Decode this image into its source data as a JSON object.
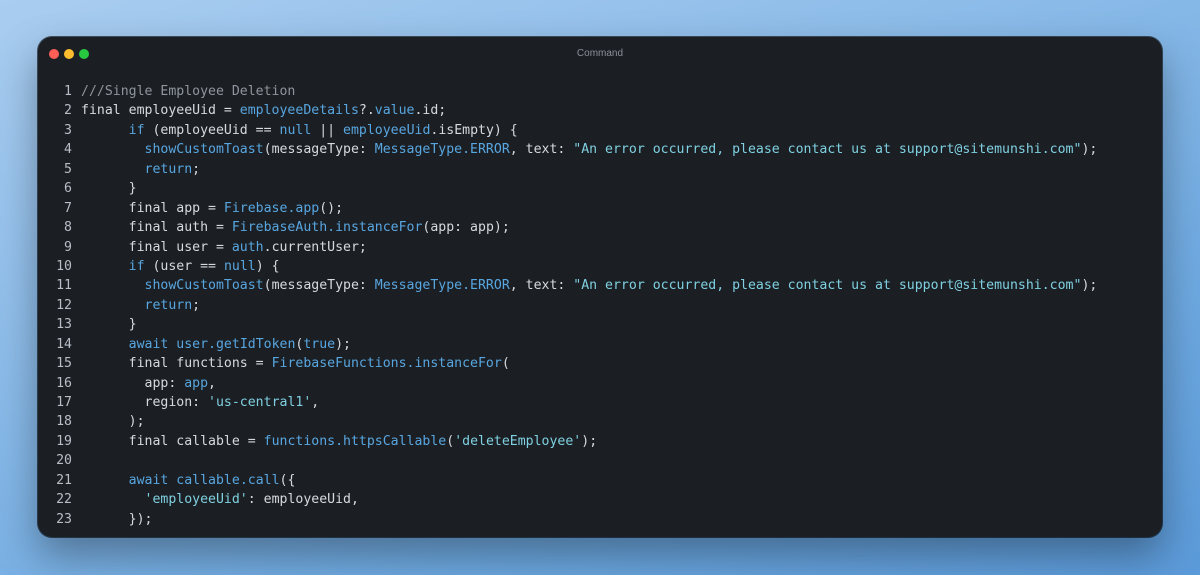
{
  "window": {
    "title": "Command",
    "traffic_lights": {
      "close": "#ff5f57",
      "minimize": "#febc2e",
      "zoom": "#28c840"
    }
  },
  "theme": {
    "background": "#1b1f24",
    "plain": "#d6dadf",
    "comment": "#8e959c",
    "keyword": "#58a6e0",
    "string": "#7fd0e0",
    "line_number": "#b8bec6"
  },
  "code_lines": [
    {
      "n": "1",
      "tokens": [
        [
          "comment",
          "///Single Employee Deletion"
        ]
      ]
    },
    {
      "n": "2",
      "tokens": [
        [
          "plain",
          "final employeeUid = "
        ],
        [
          "fn",
          "employeeDetails"
        ],
        [
          "plain",
          "?."
        ],
        [
          "fn",
          "value"
        ],
        [
          "plain",
          ".id;"
        ]
      ]
    },
    {
      "n": "3",
      "tokens": [
        [
          "plain",
          "      "
        ],
        [
          "keyword",
          "if"
        ],
        [
          "plain",
          " (employeeUid == "
        ],
        [
          "keyword",
          "null"
        ],
        [
          "plain",
          " || "
        ],
        [
          "fn",
          "employeeUid"
        ],
        [
          "plain",
          ".isEmpty) {"
        ]
      ]
    },
    {
      "n": "4",
      "tokens": [
        [
          "plain",
          "        "
        ],
        [
          "fn",
          "showCustomToast"
        ],
        [
          "plain",
          "(messageType: "
        ],
        [
          "type",
          "MessageType.ERROR"
        ],
        [
          "plain",
          ", text: "
        ],
        [
          "string",
          "\"An error occurred, please contact us at support@sitemunshi.com\""
        ],
        [
          "plain",
          ");"
        ]
      ]
    },
    {
      "n": "5",
      "tokens": [
        [
          "plain",
          "        "
        ],
        [
          "keyword",
          "return"
        ],
        [
          "plain",
          ";"
        ]
      ]
    },
    {
      "n": "6",
      "tokens": [
        [
          "plain",
          "      }"
        ]
      ]
    },
    {
      "n": "7",
      "tokens": [
        [
          "plain",
          "      final app = "
        ],
        [
          "fn",
          "Firebase.app"
        ],
        [
          "plain",
          "();"
        ]
      ]
    },
    {
      "n": "8",
      "tokens": [
        [
          "plain",
          "      final auth = "
        ],
        [
          "fn",
          "FirebaseAuth.instanceFor"
        ],
        [
          "plain",
          "(app: app);"
        ]
      ]
    },
    {
      "n": "9",
      "tokens": [
        [
          "plain",
          "      final user = "
        ],
        [
          "fn",
          "auth"
        ],
        [
          "plain",
          ".currentUser;"
        ]
      ]
    },
    {
      "n": "10",
      "tokens": [
        [
          "plain",
          "      "
        ],
        [
          "keyword",
          "if"
        ],
        [
          "plain",
          " (user == "
        ],
        [
          "keyword",
          "null"
        ],
        [
          "plain",
          ") {"
        ]
      ]
    },
    {
      "n": "11",
      "tokens": [
        [
          "plain",
          "        "
        ],
        [
          "fn",
          "showCustomToast"
        ],
        [
          "plain",
          "(messageType: "
        ],
        [
          "type",
          "MessageType.ERROR"
        ],
        [
          "plain",
          ", text: "
        ],
        [
          "string",
          "\"An error occurred, please contact us at support@sitemunshi.com\""
        ],
        [
          "plain",
          ");"
        ]
      ]
    },
    {
      "n": "12",
      "tokens": [
        [
          "plain",
          "        "
        ],
        [
          "keyword",
          "return"
        ],
        [
          "plain",
          ";"
        ]
      ]
    },
    {
      "n": "13",
      "tokens": [
        [
          "plain",
          "      }"
        ]
      ]
    },
    {
      "n": "14",
      "tokens": [
        [
          "plain",
          "      "
        ],
        [
          "keyword",
          "await"
        ],
        [
          "plain",
          " "
        ],
        [
          "fn",
          "user.getIdToken"
        ],
        [
          "plain",
          "("
        ],
        [
          "keyword",
          "true"
        ],
        [
          "plain",
          ");"
        ]
      ]
    },
    {
      "n": "15",
      "tokens": [
        [
          "plain",
          "      final functions = "
        ],
        [
          "fn",
          "FirebaseFunctions.instanceFor"
        ],
        [
          "plain",
          "("
        ]
      ]
    },
    {
      "n": "16",
      "tokens": [
        [
          "plain",
          "        app: "
        ],
        [
          "fn",
          "app"
        ],
        [
          "plain",
          ","
        ]
      ]
    },
    {
      "n": "17",
      "tokens": [
        [
          "plain",
          "        region: "
        ],
        [
          "string",
          "'us-central1'"
        ],
        [
          "plain",
          ","
        ]
      ]
    },
    {
      "n": "18",
      "tokens": [
        [
          "plain",
          "      );"
        ]
      ]
    },
    {
      "n": "19",
      "tokens": [
        [
          "plain",
          "      final callable = "
        ],
        [
          "fn",
          "functions.httpsCallable"
        ],
        [
          "plain",
          "("
        ],
        [
          "string",
          "'deleteEmployee'"
        ],
        [
          "plain",
          ");"
        ]
      ]
    },
    {
      "n": "20",
      "tokens": []
    },
    {
      "n": "21",
      "tokens": [
        [
          "plain",
          "      "
        ],
        [
          "keyword",
          "await"
        ],
        [
          "plain",
          " "
        ],
        [
          "fn",
          "callable.call"
        ],
        [
          "plain",
          "({"
        ]
      ]
    },
    {
      "n": "22",
      "tokens": [
        [
          "plain",
          "        "
        ],
        [
          "string",
          "'employeeUid'"
        ],
        [
          "plain",
          ": employeeUid,"
        ]
      ]
    },
    {
      "n": "23",
      "tokens": [
        [
          "plain",
          "      });"
        ]
      ]
    }
  ]
}
